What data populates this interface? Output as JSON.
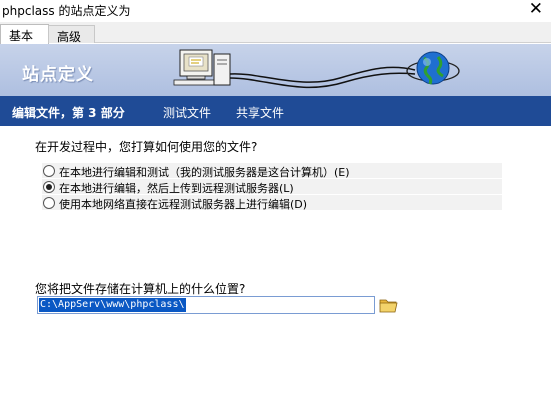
{
  "window": {
    "title": "phpclass 的站点定义为",
    "close_glyph": "✕"
  },
  "tabs": [
    {
      "label": "基本",
      "active": true
    },
    {
      "label": "高级",
      "active": false
    }
  ],
  "banner": {
    "title": "站点定义"
  },
  "nav": {
    "current": "编辑文件，第 3 部分",
    "items": [
      "测试文件",
      "共享文件"
    ]
  },
  "question1": "在开发过程中，您打算如何使用您的文件?",
  "options": [
    {
      "label": "在本地进行编辑和测试（我的测试服务器是这台计算机）(E)",
      "checked": false
    },
    {
      "label": "在本地进行编辑，然后上传到远程测试服务器(L)",
      "checked": true
    },
    {
      "label": "使用本地网络直接在远程测试服务器上进行编辑(D)",
      "checked": false
    }
  ],
  "question2": "您将把文件存储在计算机上的什么位置?",
  "path_value": "C:\\AppServ\\www\\phpclass\\",
  "icons": {
    "folder": "folder-open-icon",
    "computer": "computer-icon",
    "globe": "globe-icon"
  },
  "colors": {
    "nav_bg": "#1f4b96",
    "banner_bg": "#b6c5e4",
    "selection": "#0a58c4"
  }
}
